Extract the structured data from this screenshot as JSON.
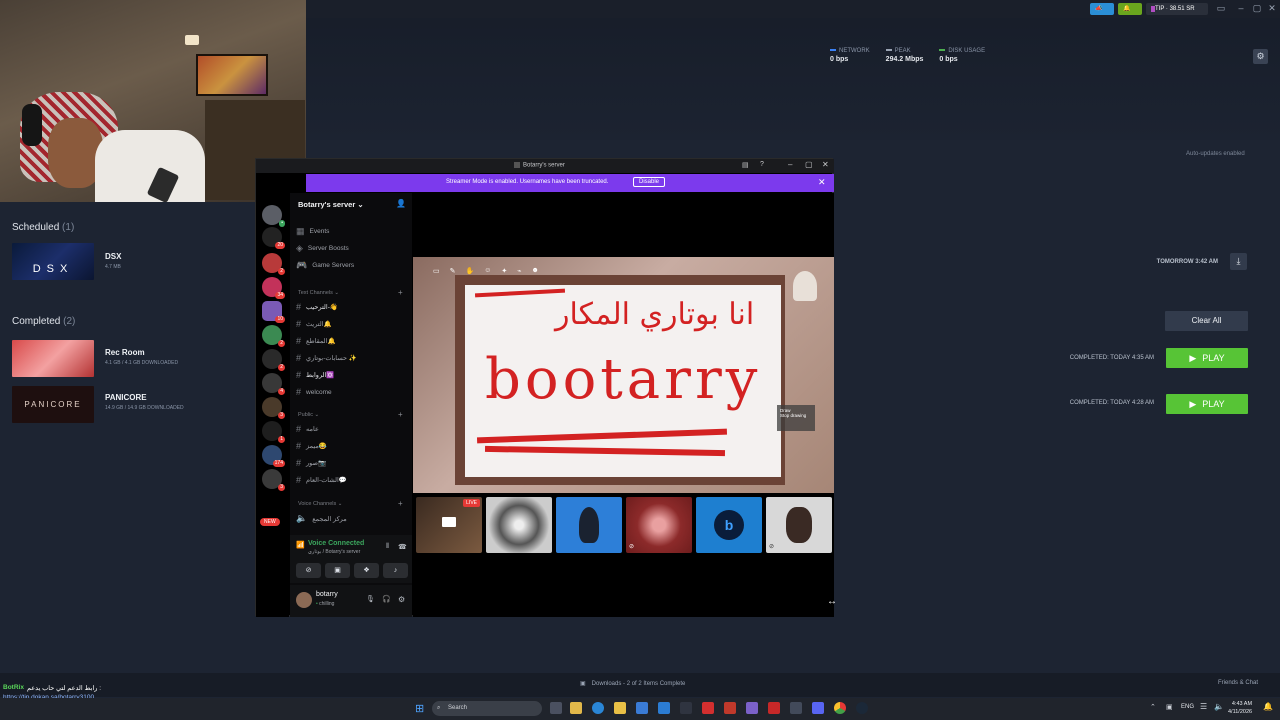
{
  "titlebar": {
    "tip_label": "TIP",
    "tip_amount": "38.51 SR"
  },
  "stats": [
    {
      "label": "NETWORK",
      "value": "0 bps",
      "color": "#3b82f6"
    },
    {
      "label": "PEAK",
      "value": "294.2 Mbps",
      "color": "#9aa4b4"
    },
    {
      "label": "DISK USAGE",
      "value": "0 bps",
      "color": "#4caf50"
    }
  ],
  "steam": {
    "auto_updates": "Auto-updates enabled",
    "scheduled": {
      "title": "Scheduled",
      "count": "(1)"
    },
    "scheduled_item": {
      "name": "DSX",
      "size": "4.7 MB",
      "time": "TOMORROW 3:42 AM",
      "thumb_text": "DSX"
    },
    "completed": {
      "title": "Completed",
      "count": "(2)"
    },
    "clear_all": "Clear All",
    "completed_items": [
      {
        "name": "Rec Room",
        "size": "4.1 GB / 4.1 GB DOWNLOADED",
        "status": "COMPLETED: TODAY 4:35 AM",
        "play": "PLAY",
        "thumb": "#c93a3a"
      },
      {
        "name": "PANICORE",
        "size": "14.9 GB / 14.9 GB DOWNLOADED",
        "status": "COMPLETED: TODAY 4:28 AM",
        "play": "PLAY",
        "thumb": "#2a1414",
        "thumb_text": "PANICORE"
      }
    ],
    "downloads_status": "Downloads - 2 of 2 Items Complete",
    "friends_chat": "Friends & Chat"
  },
  "discord": {
    "window_title": "Botarry's server",
    "streamer_notice": "Streamer Mode is enabled. Usernames have been truncated.",
    "disable": "Disable",
    "server_name": "Botarry's server",
    "menu": [
      "Events",
      "Server Boosts",
      "Game Servers"
    ],
    "text_channels_label": "Text Channels",
    "text_channels": [
      "الترحيب-👋",
      "التريث🔔",
      "المقاطع🔔",
      "حسابات-بوتاري ✨",
      "الروابط🔯",
      "welcome"
    ],
    "public_label": "Public",
    "public_channels": [
      "عامه",
      "ميمز😂",
      "صور📷",
      "الشات-العام💬"
    ],
    "voice_channels_label": "Voice Channels",
    "voice_channels": [
      "مركز المجمع"
    ],
    "voice_connected": "Voice Connected",
    "voice_server": "بوتاري / Botarry's server",
    "username": "botarry",
    "status": "chilling",
    "live_badge": "LIVE",
    "new_badge": "NEW",
    "server_badges": [
      "20",
      "2",
      "34",
      "10",
      "2",
      "2",
      "4",
      "3",
      "1",
      "174",
      "3"
    ],
    "drawing_text": "bootarry",
    "drawing_arabic": "انا بوتاري المكار",
    "draw_panel": [
      "Draw",
      "Stop drawing"
    ]
  },
  "chat": {
    "user": "BotRix",
    "message": "رابط الدعم لتي حاب يدعم :",
    "link": "https://tip.dokan.sa/botarry3100"
  },
  "taskbar": {
    "search": "Search",
    "lang": "ENG",
    "time": "4:43 AM",
    "date": "4/11/2026"
  }
}
